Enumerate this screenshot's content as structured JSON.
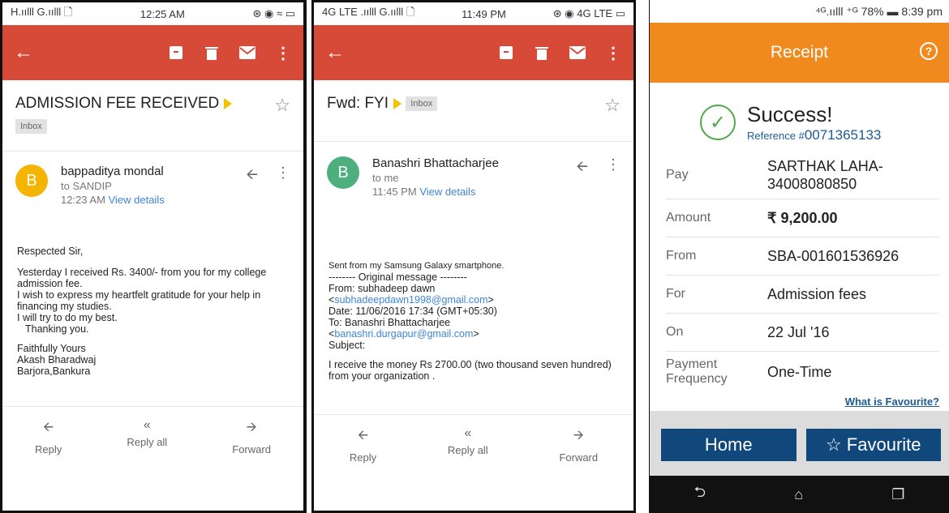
{
  "email1": {
    "status": {
      "left": "H.ıılll G.ıılll 🗋",
      "time": "12:25 AM",
      "right": "⊛ ◉ ≈ ▭"
    },
    "subject": "ADMISSION FEE RECEIVED",
    "label": "Inbox",
    "avatar": "B",
    "avatar_color": "#f4b400",
    "sender": "bappaditya mondal",
    "to": "to SANDIP",
    "time": "12:23 AM",
    "view_details": "View details",
    "body": [
      "Respected Sir,",
      "Yesterday I received Rs. 3400/- from you for my college admission fee.",
      "I wish to express my heartfelt gratitude for your help in financing my studies.",
      "I will try to do my best.",
      "Thanking you.",
      "Faithfully Yours",
      "Akash Bharadwaj",
      "Barjora,Bankura"
    ],
    "actions": [
      "Reply",
      "Reply all",
      "Forward"
    ]
  },
  "email2": {
    "status": {
      "left": "4G LTE .ıılll G.ıılll 🗋",
      "time": "11:49 PM",
      "right": "⊛ ◉ 4G LTE ▭"
    },
    "subject": "Fwd: FYI",
    "label": "Inbox",
    "avatar": "B",
    "avatar_color": "#4caf7d",
    "sender": "Banashri Bhattacharjee",
    "to": "to me",
    "time": "11:45 PM",
    "view_details": "View details",
    "sent_from": "Sent from my Samsung Galaxy smartphone.",
    "orig": "-------- Original message --------",
    "from": "From: subhadeep dawn",
    "from_email": "subhadeepdawn1998@gmail.com",
    "date": "Date: 11/06/2016 17:34 (GMT+05:30)",
    "to_line": "To: Banashri Bhattacharjee",
    "to_email": "banashri.durgapur@gmail.com",
    "subject_line": "Subject:",
    "message": "I receive the money Rs 2700.00 (two thousand seven hundred) from your organization .",
    "actions": [
      "Reply",
      "Reply all",
      "Forward"
    ]
  },
  "receipt": {
    "status": "⁴ᴳ.ıılll ⁺ᴳ 78% ▬ 8:39 pm",
    "title": "Receipt",
    "help": "?",
    "success": "Success!",
    "ref_label": "Reference #",
    "ref_num": "0071365133",
    "rows": [
      {
        "k": "Pay",
        "v": "SARTHAK LAHA-34008080850"
      },
      {
        "k": "Amount",
        "v": "₹ 9,200.00"
      },
      {
        "k": "From",
        "v": "SBA-001601536926"
      },
      {
        "k": "For",
        "v": "Admission fees"
      },
      {
        "k": "On",
        "v": "22 Jul '16"
      },
      {
        "k": "Payment Frequency",
        "v": "One-Time"
      }
    ],
    "fav_link": "What is Favourite?",
    "home": "Home",
    "favourite": "☆ Favourite",
    "nav": [
      "⮌",
      "⌂",
      "❐"
    ]
  }
}
